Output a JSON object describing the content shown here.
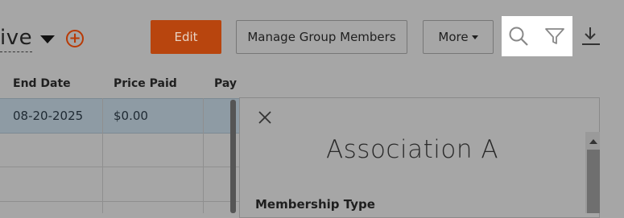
{
  "header": {
    "title_fragment": "ive",
    "edit_label": "Edit",
    "manage_label": "Manage Group Members",
    "more_label": "More"
  },
  "icons": {
    "add": "plus-circle-icon",
    "search": "search-icon",
    "filter": "filter-icon",
    "download": "download-icon",
    "close": "close-icon"
  },
  "table": {
    "columns": [
      "End Date",
      "Price Paid",
      "Pay"
    ],
    "rows": [
      [
        "08-20-2025",
        "$0.00",
        ""
      ]
    ]
  },
  "panel": {
    "title": "Association A",
    "section_label": "Membership Type"
  },
  "colors": {
    "accent": "#b8450e",
    "overlay": "#a6a6a6",
    "selected_row": "#8e9ba4"
  }
}
